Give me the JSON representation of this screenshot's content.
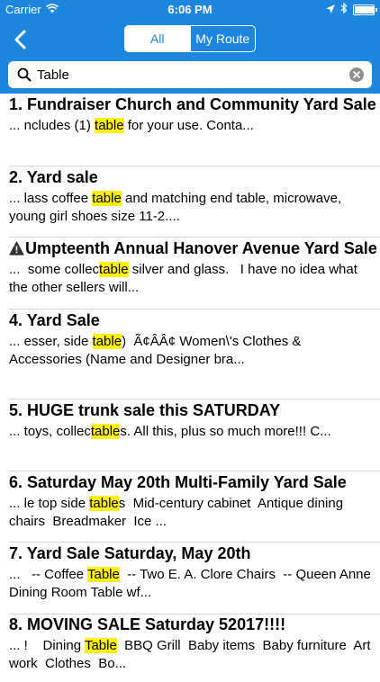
{
  "status_bar": {
    "carrier": "Carrier",
    "time": "6:06 PM"
  },
  "nav": {
    "segments": [
      "All",
      "My Route"
    ],
    "selected_segment": "All"
  },
  "search": {
    "value": "Table"
  },
  "colors": {
    "nav_blue": "#1f86de",
    "highlight": "#fef10f",
    "separator": "#d7d7d9"
  },
  "results": [
    {
      "title": "1. Fundraiser Church and Community Yard Sale",
      "warning": false,
      "snippet": [
        {
          "t": "... ncludes (1) ",
          "h": false
        },
        {
          "t": "table",
          "h": true
        },
        {
          "t": " for your use. Conta...",
          "h": false
        }
      ]
    },
    {
      "title": "2. Yard sale",
      "warning": false,
      "snippet": [
        {
          "t": "... lass coffee ",
          "h": false
        },
        {
          "t": "table",
          "h": true
        },
        {
          "t": " and matching end table, microwave, young girl shoes size 11-2....",
          "h": false
        }
      ]
    },
    {
      "title": "Umpteenth Annual Hanover Avenue Yard Sale",
      "warning": true,
      "snippet": [
        {
          "t": "...  some collec",
          "h": false
        },
        {
          "t": "table",
          "h": true
        },
        {
          "t": " silver and glass.   I have no idea what the other sellers will...",
          "h": false
        }
      ]
    },
    {
      "title": "4. Yard Sale",
      "warning": false,
      "snippet": [
        {
          "t": "... esser, side ",
          "h": false
        },
        {
          "t": "table",
          "h": true
        },
        {
          "t": ")  Ã¢ÂÂ¢ Women\\'s Clothes & Accessories (Name and Designer bra...",
          "h": false
        }
      ]
    },
    {
      "title": "5. HUGE trunk sale this SATURDAY",
      "warning": false,
      "snippet": [
        {
          "t": "... toys, collec",
          "h": false
        },
        {
          "t": "table",
          "h": true
        },
        {
          "t": "s. All this, plus so much more!!! C...",
          "h": false
        }
      ]
    },
    {
      "title": "6. Saturday May 20th Multi-Family Yard Sale",
      "warning": false,
      "snippet": [
        {
          "t": "... le top side ",
          "h": false
        },
        {
          "t": "table",
          "h": true
        },
        {
          "t": "s  Mid-century cabinet  Antique dining chairs  Breadmaker  Ice ...",
          "h": false
        }
      ]
    },
    {
      "title": "7. Yard Sale Saturday, May 20th",
      "warning": false,
      "snippet": [
        {
          "t": "...   -- Coffee ",
          "h": false
        },
        {
          "t": "Table",
          "h": true
        },
        {
          "t": "  -- Two E. A. Clore Chairs  -- Queen Anne Dining Room Table wf...",
          "h": false
        }
      ]
    },
    {
      "title": "8. MOVING SALE Saturday 52017!!!!",
      "warning": false,
      "snippet": [
        {
          "t": "... !    Dining ",
          "h": false
        },
        {
          "t": "Table",
          "h": true
        },
        {
          "t": "  BBQ Grill  Baby items  Baby furniture  Art work  Clothes  Bo...",
          "h": false
        }
      ]
    }
  ]
}
